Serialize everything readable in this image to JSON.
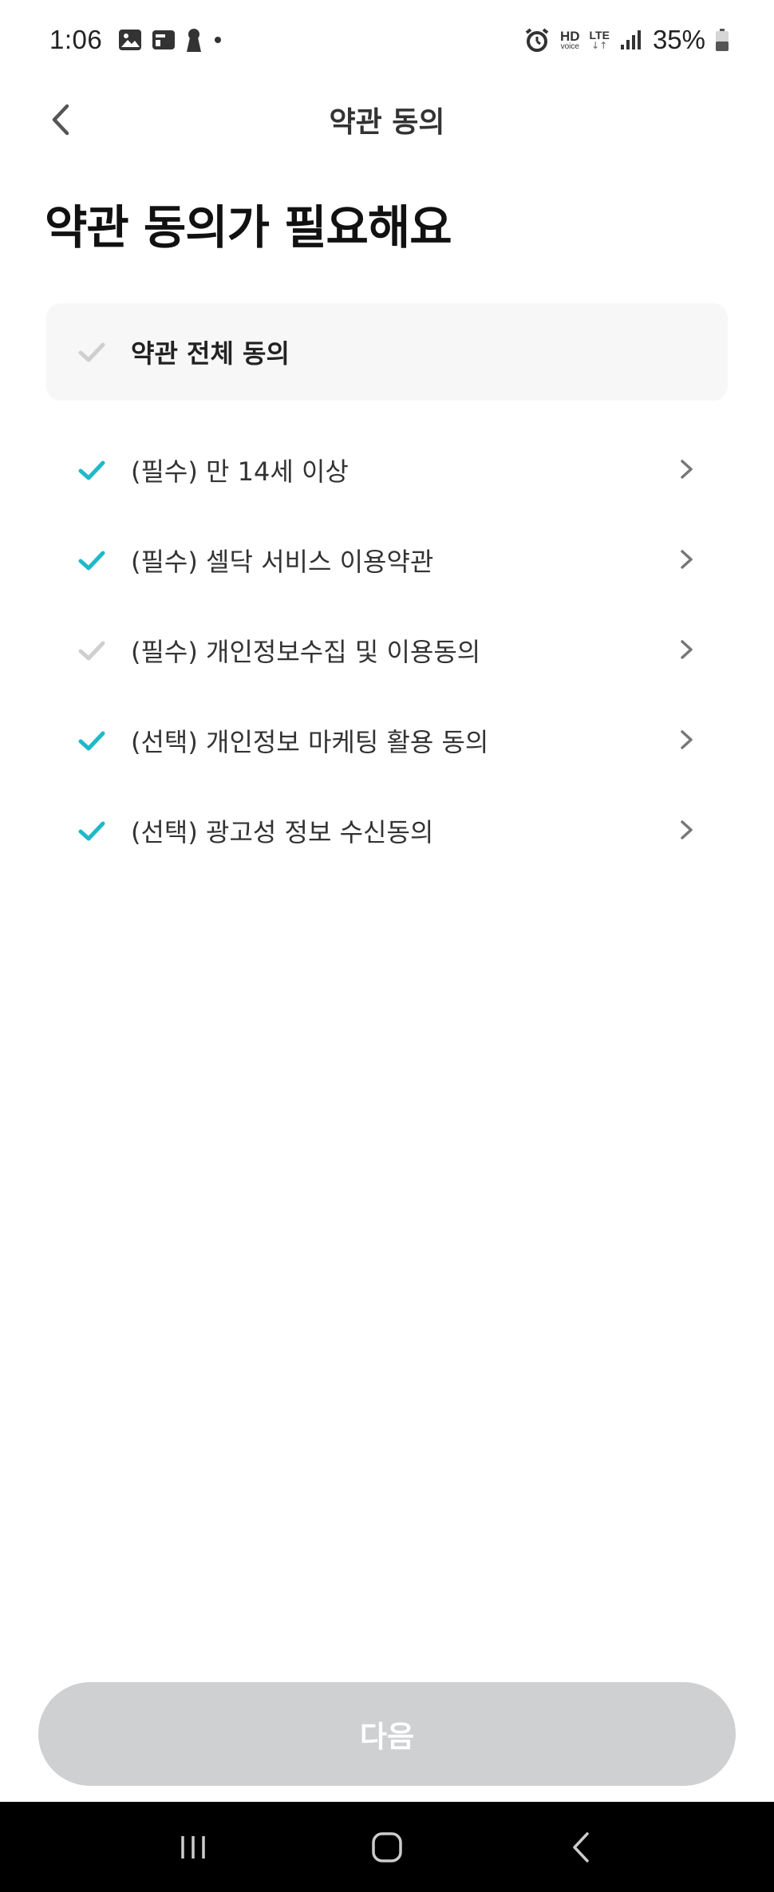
{
  "status_bar": {
    "time": "1:06",
    "left_icons": [
      "gallery-icon",
      "card-icon",
      "keyhole-icon",
      "dot-icon"
    ],
    "hd_top": "HD",
    "hd_bottom": "voice",
    "lte": "LTE",
    "battery_percent": "35%"
  },
  "header": {
    "title": "약관 동의",
    "back_icon": "chevron-left-icon"
  },
  "page_title": "약관 동의가 필요해요",
  "agree_all": {
    "label": "약관 전체 동의",
    "checked": false
  },
  "terms": [
    {
      "label": "(필수) 만 14세 이상",
      "checked": true
    },
    {
      "label": "(필수) 셀닥 서비스 이용약관",
      "checked": true
    },
    {
      "label": "(필수) 개인정보수집 및 이용동의",
      "checked": false
    },
    {
      "label": "(선택) 개인정보 마케팅 활용 동의",
      "checked": true
    },
    {
      "label": "(선택) 광고성 정보 수신동의",
      "checked": true
    }
  ],
  "next_button": {
    "label": "다음",
    "enabled": false
  },
  "colors": {
    "check_active": "#1fb9c9",
    "check_inactive": "#cfcfcf",
    "button_disabled": "#cfd0d2",
    "agree_all_bg": "#f7f7f8"
  },
  "nav_bar": {
    "icons": [
      "recent-apps-icon",
      "home-icon",
      "back-icon"
    ]
  }
}
